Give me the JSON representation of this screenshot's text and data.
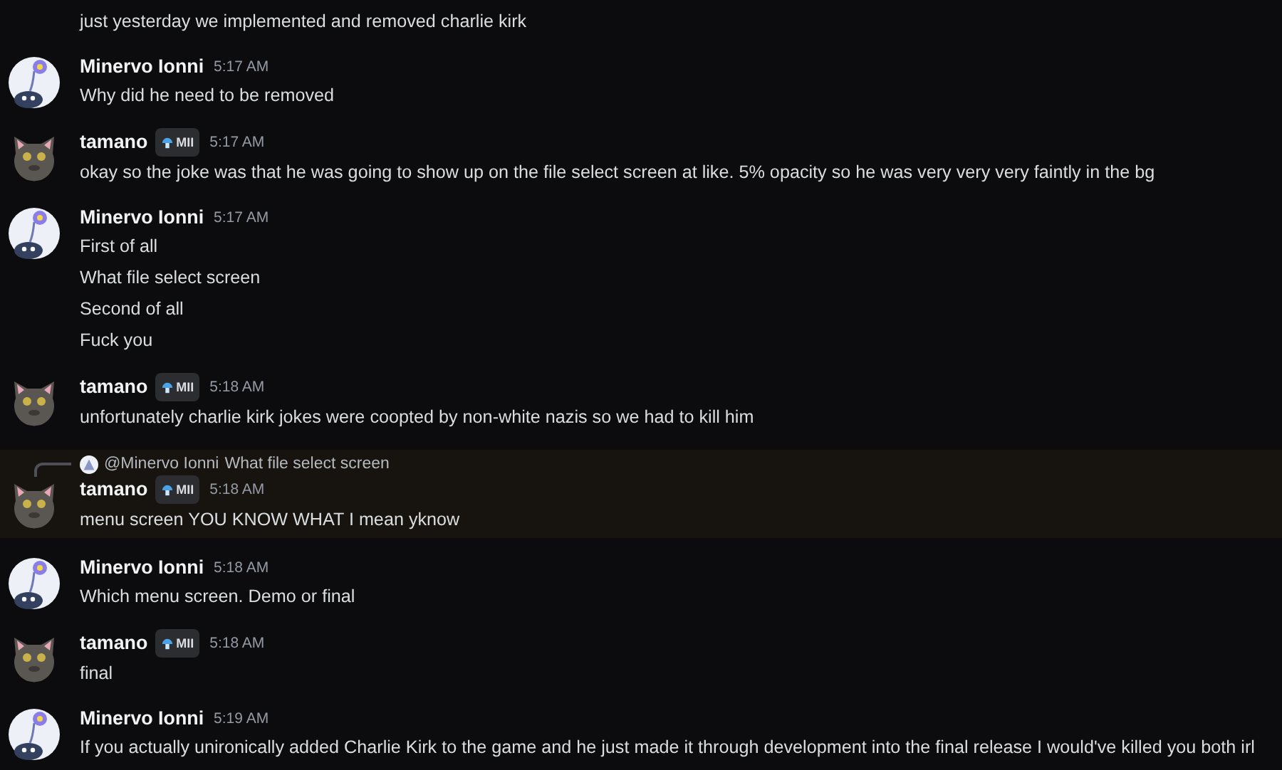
{
  "messages": [
    {
      "lines": [
        "just yesterday we implemented and removed charlie kirk"
      ],
      "highlighted": false
    },
    {
      "kind": "flower",
      "author": "Minervo Ionni",
      "time": "5:17 AM",
      "lines": [
        "Why did he need to be removed"
      ],
      "highlighted": false
    },
    {
      "kind": "cat",
      "author": "tamano",
      "badge": "MII",
      "time": "5:17 AM",
      "lines": [
        "okay so the joke was that he was going to show up on the file select screen at like. 5% opacity so he was very very very faintly in the bg"
      ],
      "highlighted": false
    },
    {
      "kind": "flower",
      "author": "Minervo Ionni",
      "time": "5:17 AM",
      "lines": [
        "First of all",
        "What file select screen",
        "Second of all",
        "Fuck you"
      ],
      "highlighted": false
    },
    {
      "kind": "cat",
      "author": "tamano",
      "badge": "MII",
      "time": "5:18 AM",
      "lines": [
        "unfortunately charlie kirk jokes were coopted by non-white nazis so we had to kill him"
      ],
      "highlighted": false
    },
    {
      "kind": "cat",
      "author": "tamano",
      "badge": "MII",
      "time": "5:18 AM",
      "reply": {
        "author": "@Minervo Ionni",
        "text": "What file select screen"
      },
      "lines": [
        "menu screen YOU KNOW WHAT I mean yknow"
      ],
      "highlighted": true
    },
    {
      "kind": "flower",
      "author": "Minervo Ionni",
      "time": "5:18 AM",
      "lines": [
        "Which menu screen. Demo or final"
      ],
      "highlighted": false
    },
    {
      "kind": "cat",
      "author": "tamano",
      "badge": "MII",
      "time": "5:18 AM",
      "lines": [
        "final"
      ],
      "highlighted": false
    },
    {
      "kind": "flower",
      "author": "Minervo Ionni",
      "time": "5:19 AM",
      "lines": [
        "If you actually unironically added Charlie Kirk to the game and he just made it through development into the final release I would've killed you both irl"
      ],
      "highlighted": false
    }
  ]
}
